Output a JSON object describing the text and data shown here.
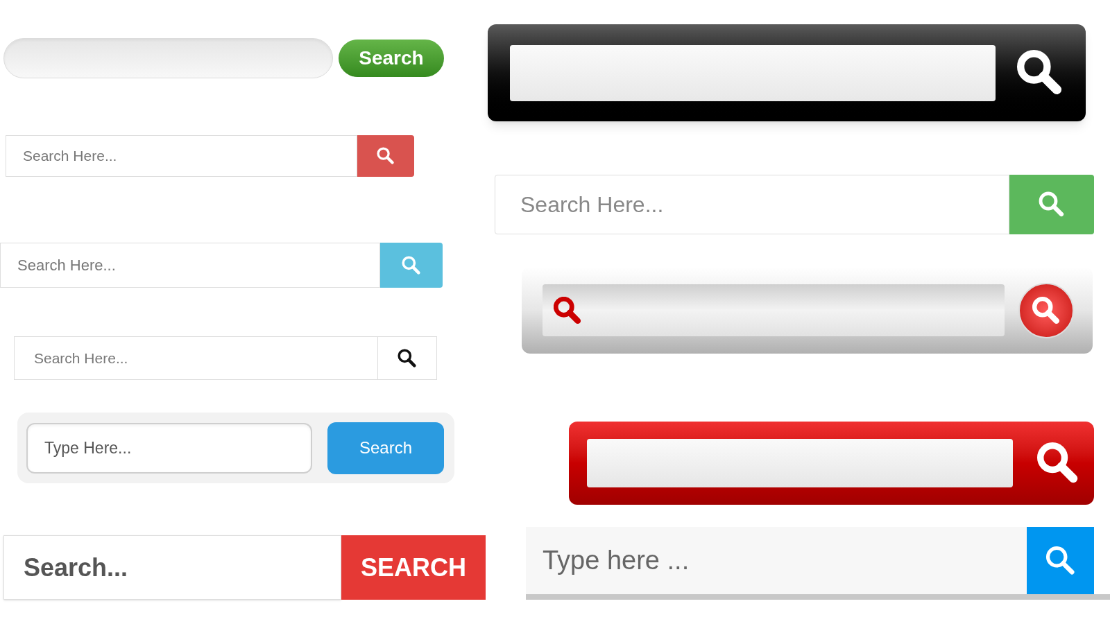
{
  "left": [
    {
      "kind": "pill",
      "button": "Search"
    },
    {
      "kind": "flat-red",
      "placeholder": "Search Here..."
    },
    {
      "kind": "flat-cyan",
      "placeholder": "Search Here..."
    },
    {
      "kind": "outline",
      "placeholder": "Search Here..."
    },
    {
      "kind": "rounded-blue",
      "placeholder": "Type Here...",
      "button": "Search"
    },
    {
      "kind": "bold-red",
      "placeholder": "Search...",
      "button": "SEARCH"
    }
  ],
  "right": [
    {
      "kind": "dark-glossy"
    },
    {
      "kind": "flat-green",
      "placeholder": "Search Here..."
    },
    {
      "kind": "silver"
    },
    {
      "kind": "red-glossy"
    },
    {
      "kind": "flat-blue",
      "placeholder": "Type here ..."
    }
  ]
}
